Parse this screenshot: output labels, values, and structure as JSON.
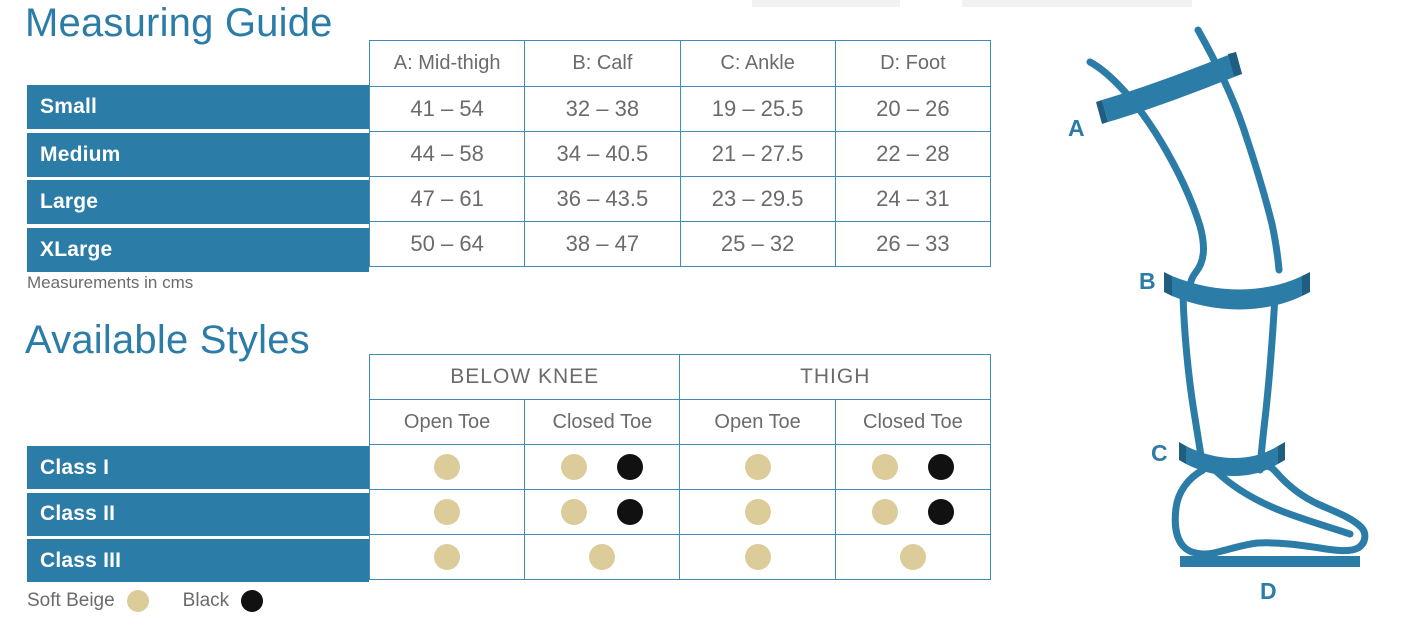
{
  "page": {
    "background_color": "#ffffff",
    "accent_color": "#2C7CA8",
    "beige_color": "#DCCC9A",
    "black_color": "#111111",
    "text_gray": "#6B6B6B"
  },
  "measuring_guide": {
    "heading": "Measuring Guide",
    "footnote": "Measurements in cms",
    "columns": [
      "A: Mid-thigh",
      "B: Calf",
      "C: Ankle",
      "D: Foot"
    ],
    "rows": [
      {
        "label": "Small",
        "values": [
          "41 – 54",
          "32 – 38",
          "19 – 25.5",
          "20 – 26"
        ]
      },
      {
        "label": "Medium",
        "values": [
          "44 – 58",
          "34 – 40.5",
          "21 – 27.5",
          "22 – 28"
        ]
      },
      {
        "label": "Large",
        "values": [
          "47 – 61",
          "36 – 43.5",
          "23 – 29.5",
          "24 – 31"
        ]
      },
      {
        "label": "XLarge",
        "values": [
          "50 – 64",
          "38 – 47",
          "25 – 32",
          "26 – 33"
        ]
      }
    ]
  },
  "available_styles": {
    "heading": "Available Styles",
    "group_headers": [
      "BELOW KNEE",
      "THIGH"
    ],
    "sub_headers": [
      "Open Toe",
      "Closed Toe",
      "Open Toe",
      "Closed Toe"
    ],
    "rows": [
      {
        "label": "Class I",
        "cells": [
          [
            "beige"
          ],
          [
            "beige",
            "black"
          ],
          [
            "beige"
          ],
          [
            "beige",
            "black"
          ]
        ]
      },
      {
        "label": "Class II",
        "cells": [
          [
            "beige"
          ],
          [
            "beige",
            "black"
          ],
          [
            "beige"
          ],
          [
            "beige",
            "black"
          ]
        ]
      },
      {
        "label": "Class III",
        "cells": [
          [
            "beige"
          ],
          [
            "beige"
          ],
          [
            "beige"
          ],
          [
            "beige"
          ]
        ]
      }
    ],
    "legend": [
      {
        "label": "Soft Beige",
        "color": "#DCCC9A"
      },
      {
        "label": "Black",
        "color": "#111111"
      }
    ]
  },
  "leg_diagram": {
    "labels": {
      "a": "A",
      "b": "B",
      "c": "C",
      "d": "D"
    },
    "stroke_color": "#2C7CA8"
  }
}
